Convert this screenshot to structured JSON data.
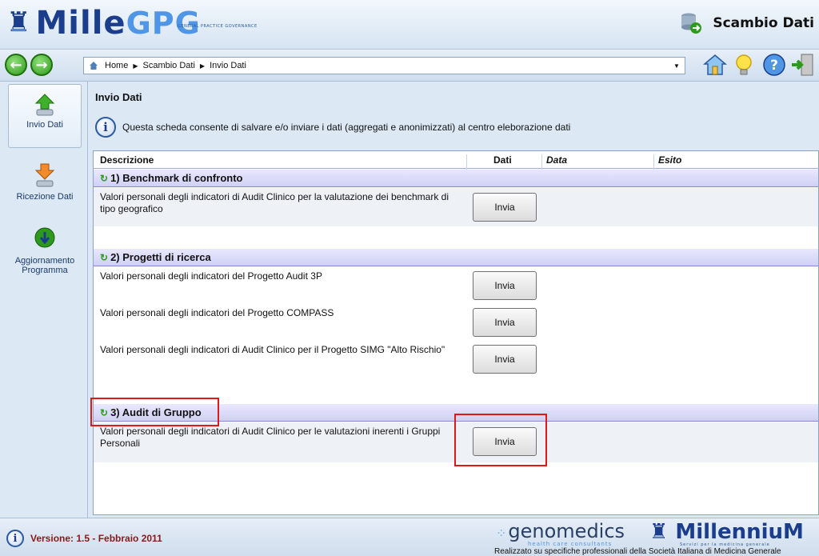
{
  "header": {
    "logo_main": "Mille",
    "logo_gpg": "GPG",
    "logo_sub": "GENERAL PRACTICE GOVERNANCE",
    "app_title": "Scambio Dati"
  },
  "navbar": {
    "breadcrumb": [
      "Home",
      "Scambio Dati",
      "Invio Dati"
    ]
  },
  "sidebar": {
    "items": [
      {
        "label": "Invio Dati",
        "active": true
      },
      {
        "label": "Ricezione Dati",
        "active": false
      },
      {
        "label": "Aggiornamento Programma",
        "active": false
      }
    ]
  },
  "main": {
    "title": "Invio Dati",
    "info_text": "Questa scheda consente di salvare e/o inviare i dati (aggregati e anonimizzati) al centro eleborazione dati",
    "columns": [
      "Descrizione",
      "Dati",
      "Data",
      "Esito"
    ],
    "button_label": "Invia",
    "groups": [
      {
        "title": "1) Benchmark di confronto",
        "rows": [
          "Valori personali degli indicatori di Audit Clinico per la valutazione dei benchmark di tipo geografico"
        ]
      },
      {
        "title": "2) Progetti di ricerca",
        "rows": [
          "Valori personali degli indicatori del Progetto Audit 3P",
          "Valori personali degli indicatori del Progetto COMPASS",
          "Valori personali degli indicatori di Audit Clinico per il Progetto SIMG \"Alto Rischio\""
        ]
      },
      {
        "title": "3) Audit di Gruppo",
        "rows": [
          "Valori personali degli indicatori di Audit Clinico per le valutazioni inerenti i Gruppi Personali"
        ]
      }
    ]
  },
  "footer": {
    "version": "Versione: 1.5 - Febbraio 2011",
    "genomedics": "genomedics",
    "genomedics_sub": "health care consultants",
    "millennium": "MillenniuM",
    "millennium_sub": "Servizi per la medicina generale",
    "realizzato": "Realizzato su specifiche professionali della Società Italiana di Medicina Generale"
  },
  "colors": {
    "brand_blue": "#1a3e8c",
    "highlight_red": "#e01818",
    "group_header": "#d0d0f5"
  },
  "icons": [
    "back-arrow-icon",
    "forward-arrow-icon",
    "home-icon",
    "lightbulb-icon",
    "help-icon",
    "exit-door-icon",
    "database-exchange-icon",
    "info-icon",
    "upload-arrow-icon",
    "download-arrow-icon",
    "globe-update-icon"
  ]
}
